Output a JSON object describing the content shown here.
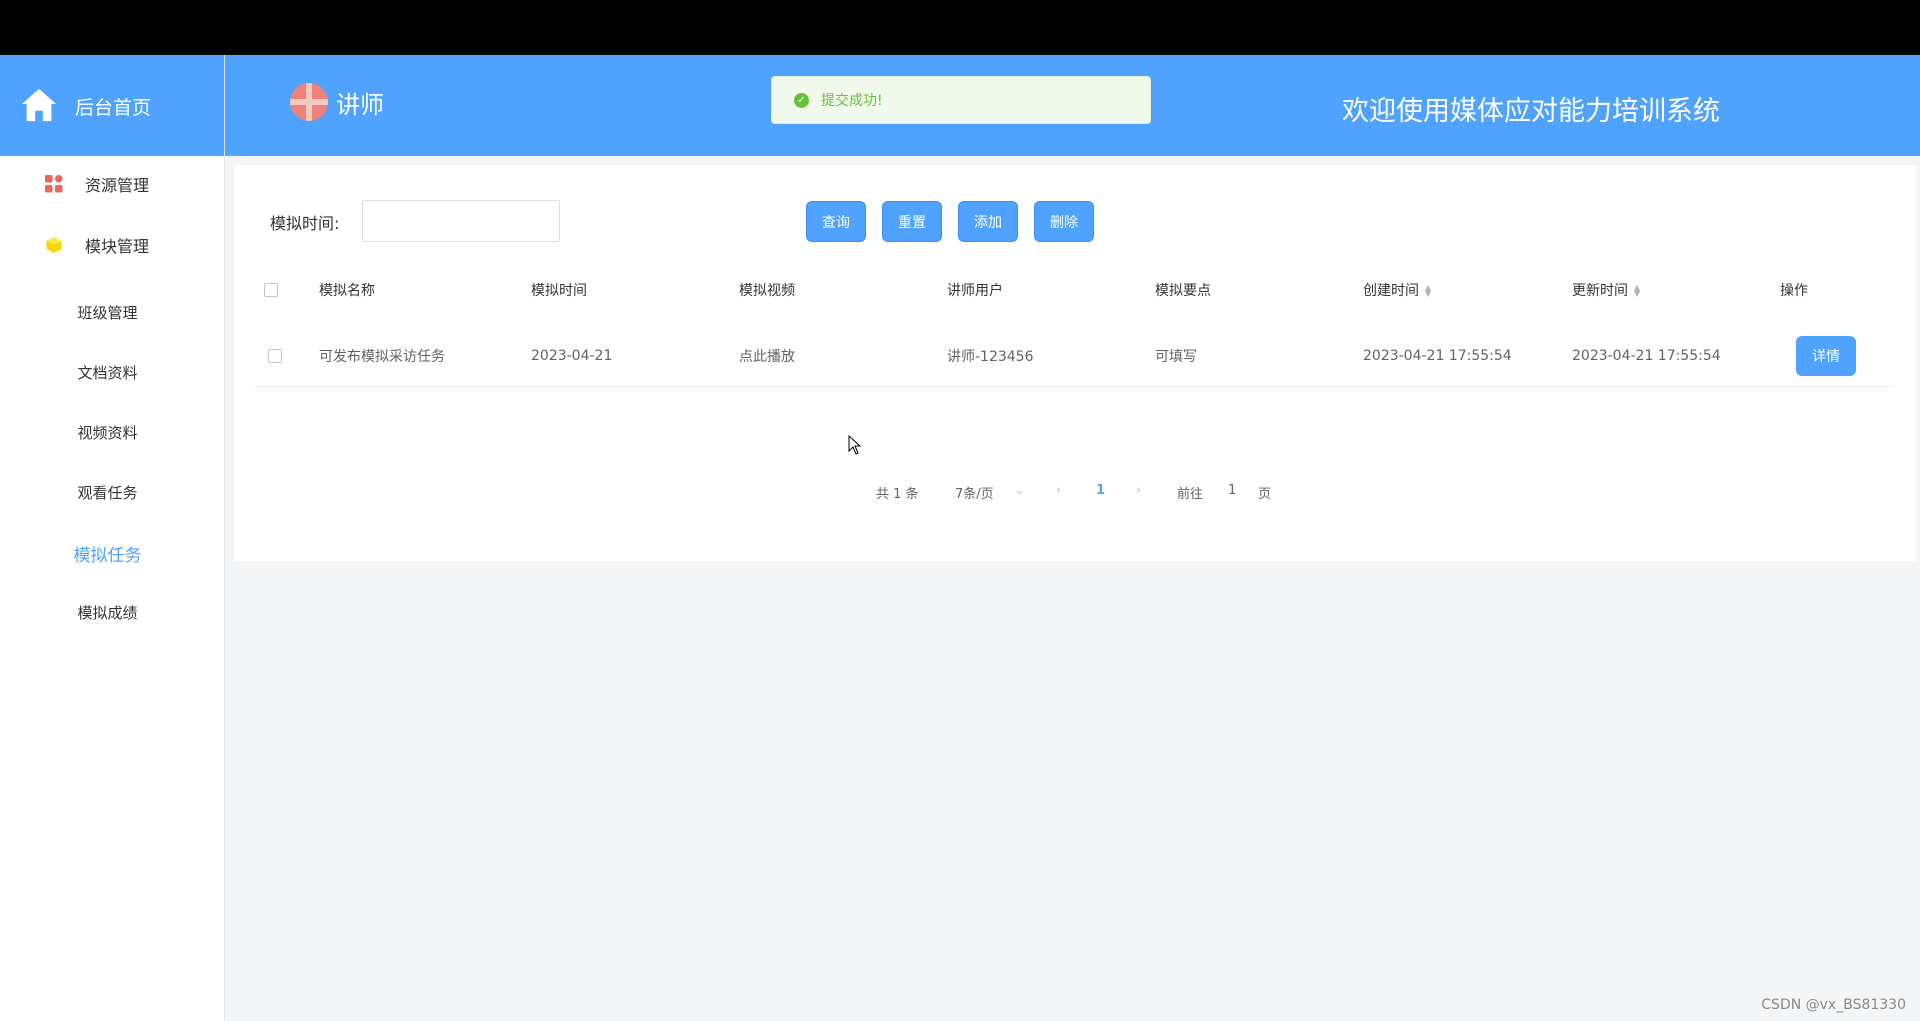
{
  "header": {
    "home_label": "后台首页",
    "user_name": "讲师",
    "toast": "提交成功!",
    "welcome": "欢迎使用媒体应对能力培训系统",
    "accent_color": "#4fa3ff"
  },
  "sidebar": {
    "groups": [
      {
        "label": "资源管理",
        "icon": "grid-icon"
      },
      {
        "label": "模块管理",
        "icon": "cube-icon"
      }
    ],
    "items": [
      {
        "label": "班级管理",
        "active": false
      },
      {
        "label": "文档资料",
        "active": false
      },
      {
        "label": "视频资料",
        "active": false
      },
      {
        "label": "观看任务",
        "active": false
      },
      {
        "label": "模拟任务",
        "active": true
      },
      {
        "label": "模拟成绩",
        "active": false
      }
    ]
  },
  "filter": {
    "label": "模拟时间:",
    "value": ""
  },
  "toolbar": {
    "query": "查询",
    "reset": "重置",
    "add": "添加",
    "delete": "删除"
  },
  "table": {
    "headers": [
      "模拟名称",
      "模拟时间",
      "模拟视频",
      "讲师用户",
      "模拟要点",
      "创建时间",
      "更新时间",
      "操作"
    ],
    "rows": [
      {
        "name": "可发布模拟采访任务",
        "time": "2023-04-21",
        "video": "点此播放",
        "user": "讲师-123456",
        "points": "可填写",
        "created": "2023-04-21 17:55:54",
        "updated": "2023-04-21 17:55:54",
        "action": "详情"
      }
    ]
  },
  "pagination": {
    "total": "共 1 条",
    "page_size": "7条/页",
    "current": "1",
    "goto_label": "前往",
    "goto_value": "1",
    "page_suffix": "页"
  },
  "watermark": "CSDN @vx_BS81330"
}
